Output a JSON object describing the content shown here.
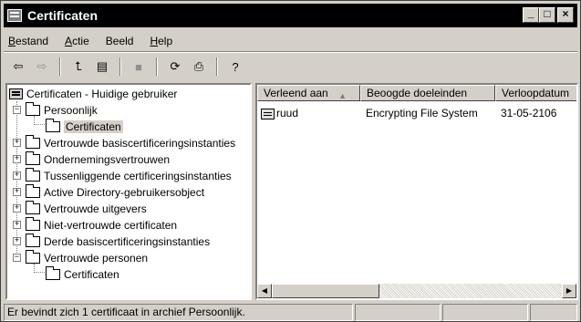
{
  "window": {
    "title": "Certificaten"
  },
  "title_buttons": {
    "minimize": "_",
    "maximize": "□",
    "close": "×"
  },
  "menu": [
    {
      "label": "Bestand",
      "accel": "B",
      "rest": "estand"
    },
    {
      "label": "Actie",
      "accel": "A",
      "rest": "ctie"
    },
    {
      "label": "Beeld",
      "accel": "B",
      "rest": "eeld",
      "pre": ""
    },
    {
      "label": "Help",
      "accel": "H",
      "rest": "elp"
    }
  ],
  "toolbar": [
    {
      "icon": "back-arrow-icon",
      "glyph": "⇦",
      "enabled": true
    },
    {
      "icon": "forward-arrow-icon",
      "glyph": "⇨",
      "enabled": false
    },
    {
      "icon": "up-folder-icon",
      "glyph": "⮤",
      "enabled": true
    },
    {
      "icon": "show-hide-tree-icon",
      "glyph": "▤",
      "enabled": true
    },
    {
      "icon": "delete-icon",
      "glyph": "■",
      "enabled": false
    },
    {
      "icon": "refresh-icon",
      "glyph": "⟳",
      "enabled": true
    },
    {
      "icon": "export-list-icon",
      "glyph": "⎙",
      "enabled": true
    },
    {
      "icon": "help-icon",
      "glyph": "?",
      "enabled": true
    }
  ],
  "tree": {
    "root": "Certificaten - Huidige gebruiker",
    "nodes": [
      {
        "label": "Persoonlijk",
        "expanded": true
      },
      {
        "label": "Certificaten",
        "child": true,
        "selected": true
      },
      {
        "label": "Vertrouwde basiscertificeringsinstanties"
      },
      {
        "label": "Ondernemingsvertrouwen"
      },
      {
        "label": "Tussenliggende certificeringsinstanties"
      },
      {
        "label": "Active Directory-gebruikersobject"
      },
      {
        "label": "Vertrouwde uitgevers"
      },
      {
        "label": "Niet-vertrouwde certificaten"
      },
      {
        "label": "Derde basiscertificeringsinstanties"
      },
      {
        "label": "Vertrouwde personen",
        "expanded": true
      },
      {
        "label": "Certificaten",
        "child": true
      }
    ]
  },
  "list": {
    "columns": [
      "Verleend aan",
      "Beoogde doeleinden",
      "Verloopdatum"
    ],
    "rows": [
      {
        "issued_to": "ruud",
        "purpose": "Encrypting File System",
        "expiry": "31-05-2106"
      }
    ]
  },
  "status": {
    "text": "Er bevindt zich 1 certificaat in archief Persoonlijk."
  }
}
